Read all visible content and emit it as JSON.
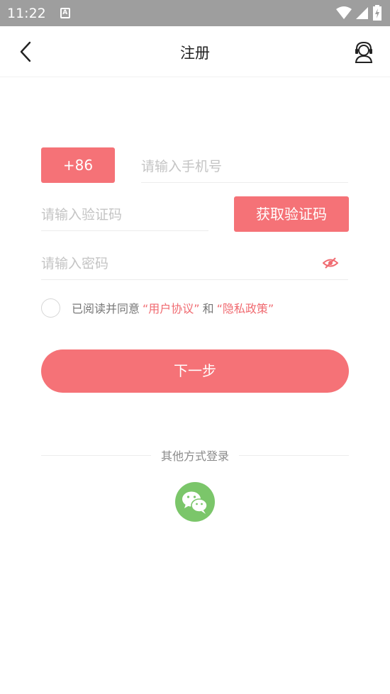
{
  "status_bar": {
    "time": "11:22",
    "notif_icon": "A"
  },
  "header": {
    "title": "注册",
    "back_icon": "chevron-left-icon",
    "service_icon": "customer-service-icon"
  },
  "form": {
    "country_code": "+86",
    "phone_placeholder": "请输入手机号",
    "code_placeholder": "请输入验证码",
    "get_code_label": "获取验证码",
    "password_placeholder": "请输入密码"
  },
  "agreement": {
    "prefix": "已阅读并同意",
    "user_agreement": "“用户协议”",
    "and": "和",
    "privacy_policy": "“隐私政策”"
  },
  "next_label": "下一步",
  "other_login": {
    "label": "其他方式登录",
    "wechat_icon": "wechat-icon"
  },
  "colors": {
    "accent": "#f57277",
    "wechat": "#7bc66a",
    "link": "#f06a70"
  }
}
